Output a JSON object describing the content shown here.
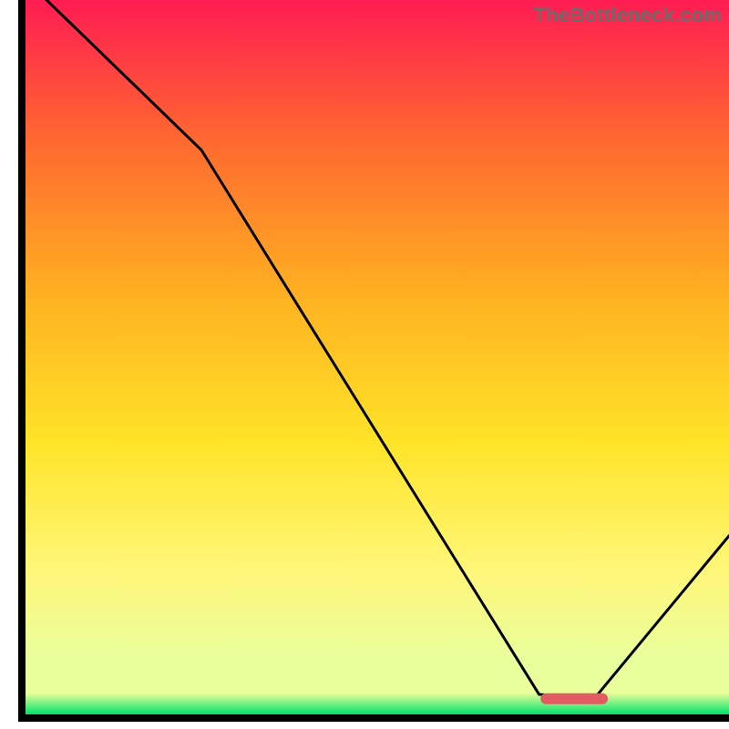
{
  "watermark": "TheBottleneck.com",
  "colors": {
    "grad_top": "#ff1c52",
    "grad_mid_upper": "#ff6a2f",
    "grad_mid": "#ffb321",
    "grad_mid_lower": "#ffe428",
    "grad_low": "#fff77a",
    "grad_pale": "#e9ff9b",
    "grad_green": "#00e06a",
    "curve": "#000000",
    "marker": "#e25b63"
  },
  "chart_data": {
    "type": "line",
    "title": "",
    "xlabel": "",
    "ylabel": "",
    "xlim": [
      0,
      100
    ],
    "ylim": [
      0,
      100
    ],
    "grid": false,
    "series": [
      {
        "name": "bottleneck-curve",
        "x": [
          3,
          25,
          73,
          78,
          81,
          100
        ],
        "values": [
          100,
          79,
          2.8,
          2.4,
          2.4,
          25
        ]
      }
    ],
    "annotations": [
      {
        "name": "optimal-marker",
        "type": "segment",
        "x0": 74,
        "x1": 82,
        "y": 2.2
      }
    ],
    "legend": false
  }
}
